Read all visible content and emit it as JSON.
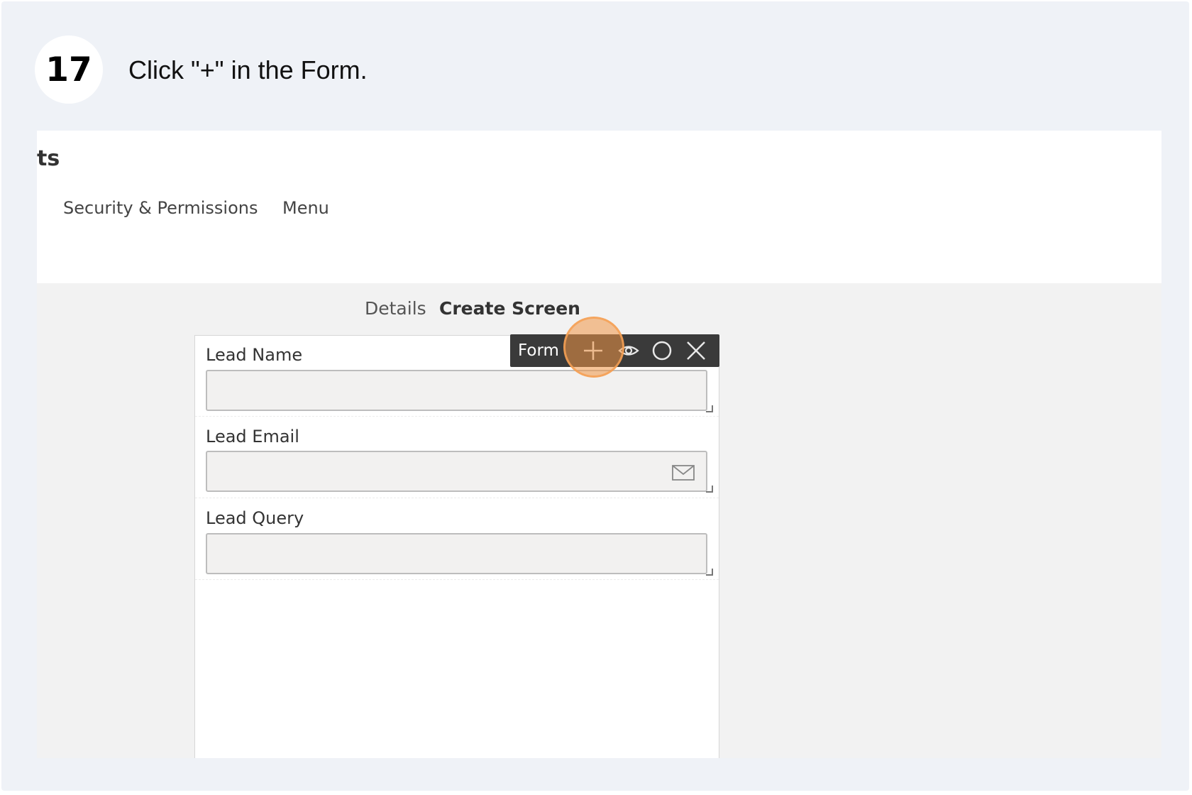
{
  "step": {
    "number": "17",
    "instruction": "Click \"+\" in the Form."
  },
  "screenshot": {
    "title_fragment": "ts",
    "nav": {
      "security": "Security & Permissions",
      "menu": "Menu"
    },
    "sub_tabs": {
      "details": "Details",
      "create_screen": "Create Screen"
    },
    "toolbar": {
      "label": "Form",
      "icons": [
        "plus-icon",
        "eye-icon",
        "circle-icon",
        "close-icon"
      ]
    },
    "fields": [
      {
        "label": "Lead Name"
      },
      {
        "label": "Lead Email",
        "icon": "mail-icon"
      },
      {
        "label": "Lead Query"
      }
    ]
  },
  "colors": {
    "card_bg": "#eff2f7",
    "toolbar_bg": "#3a3a3a",
    "highlight": "#f0a050"
  }
}
